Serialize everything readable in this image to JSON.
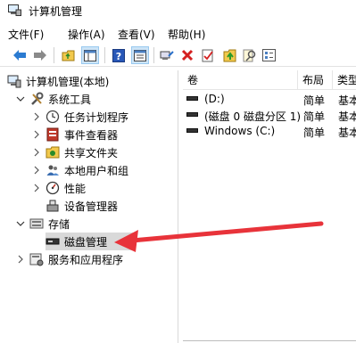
{
  "window": {
    "title": "计算机管理"
  },
  "menu": {
    "items": [
      "文件(F)",
      "操作(A)",
      "查看(V)",
      "帮助(H)"
    ]
  },
  "toolbar": {
    "buttons": [
      "back-arrow-icon",
      "forward-arrow-icon",
      "folder-up-icon",
      "show-tree-icon",
      "help-icon",
      "detail-view-icon",
      "connect-icon",
      "delete-icon",
      "check-icon",
      "folder-arrow-icon",
      "search-icon",
      "properties-icon"
    ]
  },
  "tree": {
    "root": "计算机管理(本地)",
    "system_tools": "系统工具",
    "task_scheduler": "任务计划程序",
    "event_viewer": "事件查看器",
    "shared_folders": "共享文件夹",
    "local_users": "本地用户和组",
    "performance": "性能",
    "device_manager": "设备管理器",
    "storage": "存储",
    "disk_management": "磁盘管理",
    "services_apps": "服务和应用程序"
  },
  "volumes": {
    "columns": [
      "卷",
      "布局",
      "类型"
    ],
    "rows": [
      {
        "name": "(D:)",
        "layout": "简单",
        "type": "基本"
      },
      {
        "name": "(磁盘 0 磁盘分区 1)",
        "layout": "简单",
        "type": "基本"
      },
      {
        "name": "Windows (C:)",
        "layout": "简单",
        "type": "基本"
      }
    ]
  },
  "annotation": {
    "color": "#e8333a"
  }
}
